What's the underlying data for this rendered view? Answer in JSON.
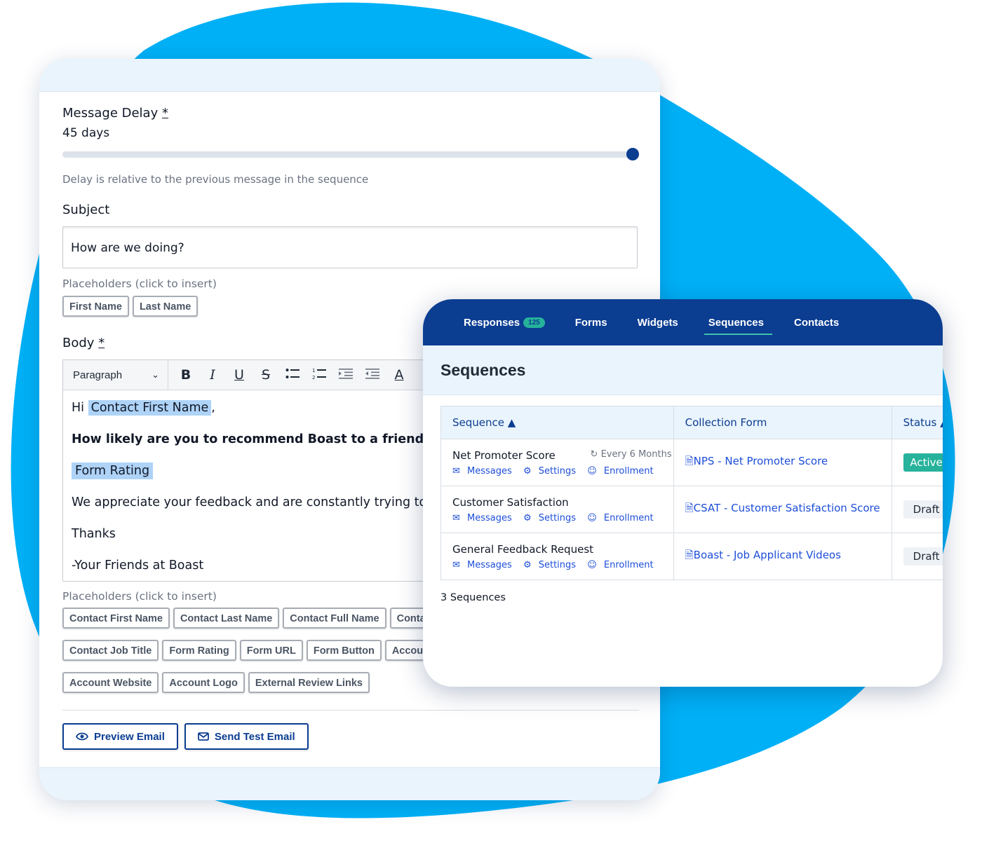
{
  "editor": {
    "message_delay": {
      "label": "Message Delay",
      "required_mark": "*",
      "value_text": "45 days",
      "slider_fraction": 1.0,
      "hint": "Delay is relative to the previous message in the sequence"
    },
    "subject": {
      "label": "Subject",
      "value": "How are we doing?",
      "placeholders_label": "Placeholders (click to insert)",
      "placeholders": [
        "First Name",
        "Last Name"
      ]
    },
    "body": {
      "label": "Body",
      "required_mark": "*",
      "format_select": "Paragraph",
      "toolbar_icons": [
        "bold-icon",
        "italic-icon",
        "underline-icon",
        "strikethrough-icon",
        "bullet-list-icon",
        "numbered-list-icon",
        "indent-icon",
        "outdent-icon",
        "text-color-icon"
      ],
      "greeting_prefix": "Hi ",
      "greeting_placeholder": "Contact First Name",
      "greeting_suffix": ",",
      "question": "How likely are you to recommend Boast to a friend or colle",
      "rating_placeholder": "Form Rating",
      "appreciation": "We appreciate your feedback and are constantly trying to impr",
      "thanks": "Thanks",
      "signature": "-Your Friends at Boast",
      "placeholders_label": "Placeholders (click to insert)",
      "placeholders": [
        "Contact First Name",
        "Contact Last Name",
        "Contact Full Name",
        "Contact I",
        "Contact Job Title",
        "Form Rating",
        "Form URL",
        "Form Button",
        "Account Co",
        "Account Website",
        "Account Logo",
        "External Review Links"
      ]
    },
    "buttons": {
      "preview": "Preview Email",
      "send_test": "Send Test Email"
    }
  },
  "sequences": {
    "nav": {
      "responses": "Responses",
      "responses_badge": "125",
      "forms": "Forms",
      "widgets": "Widgets",
      "sequences": "Sequences",
      "contacts": "Contacts"
    },
    "title": "Sequences",
    "columns": {
      "sequence": "Sequence ▲",
      "collection_form": "Collection Form",
      "status": "Status ▲"
    },
    "link_labels": {
      "messages": "Messages",
      "settings": "Settings",
      "enrollment": "Enrollment"
    },
    "rows": [
      {
        "name": "Net Promoter Score",
        "recurrence": "Every 6 Months",
        "form": "NPS - Net Promoter Score",
        "status": "Active"
      },
      {
        "name": "Customer Satisfaction",
        "recurrence": "",
        "form": "CSAT - Customer Satisfaction Score",
        "status": "Draft"
      },
      {
        "name": "General Feedback Request",
        "recurrence": "",
        "form": "Boast - Job Applicant Videos",
        "status": "Draft"
      }
    ],
    "count_text": "3 Sequences"
  },
  "colors": {
    "blob": "#00b0f6",
    "navy": "#0b3d91",
    "teal": "#26b29b",
    "link": "#1d4ed8",
    "highlight": "#aed3f7"
  }
}
